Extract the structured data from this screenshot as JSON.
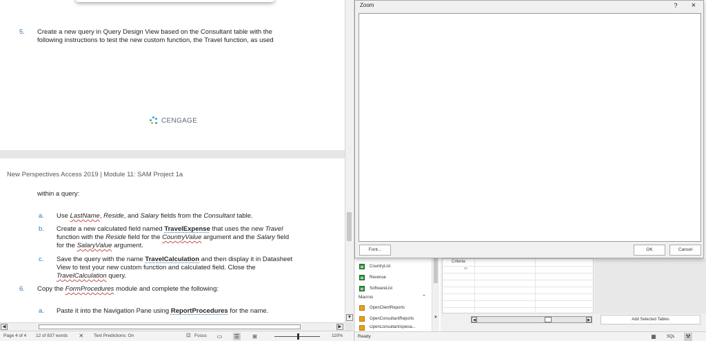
{
  "word": {
    "page1": {
      "step5_num": "5.",
      "step5_line1": "Create a new query in Query Design View based on the Consultant table with the",
      "step5_line2": "following instructions to test the new custom function, the Travel function, as used",
      "logo_text": "CENGAGE"
    },
    "page2": {
      "header": "New Perspectives Access 2019 | Module 11: SAM Project 1a",
      "within": "within a query:",
      "a_letter": "a.",
      "a_text_pre": "Use ",
      "a_f1": "LastName",
      "a_sep1": ", ",
      "a_f2": "Reside",
      "a_sep2": ", and ",
      "a_f3": "Salary",
      "a_text_post": " fields from the ",
      "a_tbl": "Consultant",
      "a_end": " table.",
      "b_letter": "b.",
      "b_l1_pre": "Create a new calculated field named ",
      "b_l1_bold": "TravelExpense",
      "b_l1_mid": " that uses the new ",
      "b_l1_it": "Travel",
      "b_l2_pre": "function with the ",
      "b_l2_it1": "Reside",
      "b_l2_mid1": " field for the ",
      "b_l2_it2": "CountryValue",
      "b_l2_mid2": " argument and the ",
      "b_l2_it3": "Salary",
      "b_l2_end": " field",
      "b_l3_pre": "for the ",
      "b_l3_it": "SalaryValue",
      "b_l3_end": " argument.",
      "c_letter": "c.",
      "c_l1_pre": "Save the query with the name ",
      "c_l1_bold": "TravelCalculation",
      "c_l1_end": " and then display it in Datasheet",
      "c_l2": "View to test your new custom function and calculated field. Close the",
      "c_l3_it": "TravelCalculation",
      "c_l3_end": " query.",
      "step6_num": "6.",
      "step6_pre": "Copy the ",
      "step6_it": "FormProcedures",
      "step6_end": " module and complete the following:",
      "a2_letter": "a.",
      "a2_pre": "Paste it into the Navigation Pane using ",
      "a2_bold": "ReportProcedures",
      "a2_end": " for the name."
    },
    "status": {
      "page": "Page 4 of 4",
      "words": "12 of 837 words",
      "track": "Text Predictions: On",
      "focus": "Focus",
      "zoom": "110%"
    }
  },
  "access": {
    "zoom_dialog": {
      "title": "Zoom",
      "help": "?",
      "close": "×",
      "font_button": "Font...",
      "ok_button": "OK",
      "cancel_button": "Cancel"
    },
    "nav": {
      "tables": [
        "CountryList",
        "Revenue",
        "SoftwareList"
      ],
      "macros_header": "Macros",
      "macros": [
        "OpenClientReports",
        "OpenConsultantReports",
        "OpenConsultantSpecia..."
      ]
    },
    "designer": {
      "criteria_label": "Criteria:",
      "or_label": "or:",
      "add_tables": "Add Selected Tables"
    },
    "status": {
      "ready": "Ready"
    }
  },
  "colors": {
    "accent_blue": "#2e74b5",
    "table_icon": "#2f8f3f",
    "macro_icon": "#e3a21a"
  }
}
